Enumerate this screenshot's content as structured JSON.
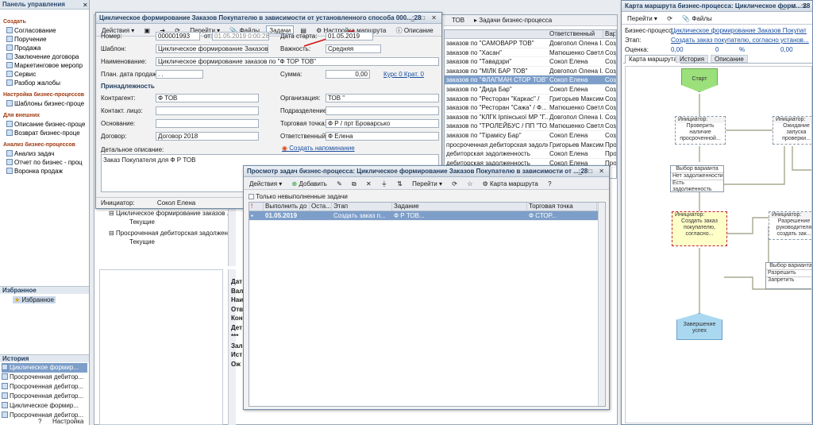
{
  "panel": {
    "title": "Панель управления",
    "sections": [
      {
        "label": "Создать",
        "items": [
          "Согласование",
          "Поручение",
          "Продажа",
          "Заключение договора",
          "Маркетинговое меропр",
          "Сервис",
          "Разбор жалобы"
        ]
      },
      {
        "label": "Настройка бизнес-процессов",
        "items": [
          "Шаблоны бизнес-проце"
        ]
      },
      {
        "label": "Для внешних",
        "items": [
          "Описание бизнес-проце",
          "Возврат бизнес-проце"
        ]
      },
      {
        "label": "Анализ бизнес-процессов",
        "items": [
          "Анализ задач",
          "Отчет по бизнес - проц",
          "Воронка продаж"
        ]
      }
    ],
    "favorites_title": "Избранное",
    "favorites_item": "Избранное",
    "history_title": "История",
    "history_items": [
      "Циклическое формир...",
      "Просроченная дебитор...",
      "Просроченная дебитор...",
      "Просроченная дебитор...",
      "Циклическое формир...",
      "Просроченная дебитор..."
    ],
    "settings": "Настройка"
  },
  "bg": {
    "tab_label": "ТОВ",
    "tasks_label": "Задачи бизнес-процесса",
    "header": [
      "",
      "Ответственный",
      "Вар"
    ],
    "rows": [
      [
        "заказов по \"САМОВАРР ТОВ\"",
        "Довгопол Олена І...",
        "Созд"
      ],
      [
        "заказов по \"Хасан\"",
        "Матюшенко Светл...",
        "Созд"
      ],
      [
        "заказов по \"Тавадзри\"",
        "Сокол Елена",
        "Созд"
      ],
      [
        "заказов по \"МІЛК БАР ТОВ\"",
        "Довгопол Олена І...",
        "Созд"
      ],
      [
        "заказов по \"ФЛАГМАН СТОР ТОВ\"",
        "Сокол Елена",
        "Созд"
      ],
      [
        "заказов по \"Дида Бар\"",
        "Сокол Елена",
        "Созд"
      ],
      [
        "заказов по \"Ресторан \"Каркас\" /",
        "Григорьев Максим",
        "Созд"
      ],
      [
        "заказов по \"Ресторан \"Сажа\" / Ф...",
        "Матюшенко Светл...",
        "Созд"
      ],
      [
        "заказов по \"КЛГК Ірпінської МР \"Г...",
        "Довгопол Олена І...",
        "Созд"
      ],
      [
        "заказов по \"ТРОЛЕЙБУС / ПП \"ТО...",
        "Матюшенко Светл...",
        "Созд"
      ],
      [
        "заказов по \"Тірамісу Бар\"",
        "Сокол Елена",
        "Созд"
      ],
      [
        "просроченная дебиторская задолжен...",
        "Григорьев Максим",
        "Прос"
      ],
      [
        "дебиторская задолженность",
        "Сокол Елена",
        "Прос"
      ],
      [
        "дебиторская задолженность",
        "Сокол Елена",
        "Прос"
      ]
    ],
    "tree": [
      {
        "title": "Циклическое формирование заказов ...",
        "sub": "Текущие"
      },
      {
        "title": "Просроченная дебиторская задолжен...",
        "sub": "Текущие"
      }
    ],
    "detail": [
      "Дат",
      "Вал",
      "Наи",
      "Отв",
      "Кон",
      "Дет",
      "***",
      "Зал",
      "Ист",
      "Ож"
    ]
  },
  "form": {
    "title": "Циклическое формирование Заказов Покупателю в зависимости от установленного способа 000...:28",
    "toolbar": [
      "Действия",
      "Перейти",
      "Файлы",
      "Задачи",
      "Настройка маршрута",
      "Описание"
    ],
    "number_label": "Номер:",
    "number": "000001993",
    "from_label": "от:",
    "from_value": "01.05.2019 0:00:28",
    "start_label": "Дата старта:",
    "start_value": "01.05.2019",
    "template_label": "Шаблон:",
    "template_value": "Циклическое формирование Заказов ...",
    "importance_label": "Важность:",
    "importance_value": "Средняя",
    "name_label": "Наименование:",
    "name_value": "Циклическое формирование заказов по \"Ф              ТОР ТОВ\"",
    "plan_label": "План. дата продажи:",
    "plan_value": ". .",
    "sum_label": "Сумма:",
    "sum_value": "0,00",
    "rate_link": "Курс 0 Крат. 0",
    "section_label": "Принадлежность",
    "contr_label": "Контрагент:",
    "contr_value": "Ф                ТОВ",
    "org_label": "Организация:",
    "org_value": "ТОВ \"",
    "contact_label": "Контакт. лицо:",
    "dept_label": "Подразделение:",
    "basis_label": "Основание:",
    "point_label": "Торговая точка:",
    "point_value": "Ф                  Р / прт Броварсько",
    "contract_label": "Договор:",
    "contract_value": "Договор           2018",
    "resp_label": "Ответственный:",
    "resp_value": "Ф                Елена",
    "desc_label": "Детальное описание:",
    "reminder": "Создать напоминание",
    "desc_text": "Заказ Покупателя для Ф                 Р ТОВ",
    "initiator_label": "Инициатор:",
    "initiator_value": "Сокол Елена"
  },
  "tasks": {
    "title": "Просмотр задач бизнес-процесса: Циклическое формирование Заказов Покупателю в зависимости от ...:28",
    "toolbar": [
      "Действия",
      "Добавить",
      "Перейти",
      "Карта маршрута"
    ],
    "checkbox": "Только невыполненные задачи",
    "header": [
      "",
      "Выполнить до",
      "Оста...",
      "Этап",
      "Задание",
      "Торговая точка"
    ],
    "row": [
      "",
      "01.05.2019",
      "",
      "Создать заказ п...",
      "Ф           Р ТОВ...",
      "Ф           СТОР..."
    ]
  },
  "map": {
    "title": "Карта маршрута бизнес-процесса: Циклическое форм...:28",
    "toolbar": [
      "Перейти",
      "Файлы"
    ],
    "bp_label": "Бизнес-процесс:",
    "bp_value": "Циклическое формирование Заказов Покупат",
    "stage_label": "Этап:",
    "stage_value": "Создать заказ покупателю, согласно установ...",
    "score_label": "Оценка:",
    "score_values": [
      "0,00",
      "0",
      "%",
      "0,00"
    ],
    "tabs": [
      "Карта маршрута",
      "История",
      "Описание"
    ],
    "nodes": {
      "start": "Старт",
      "init1": "Инициатор:",
      "check": "Проверить наличие просроченной...",
      "init2": "Инициатор:",
      "wait": "Ожидание запуска проверки...",
      "choice": "Выбор варианта",
      "no_debt": "Нет задолженности",
      "has_debt": "Есть задолженность",
      "init3": "Инициатор:",
      "create": "Создать заказ покупателю, согласно...",
      "init4": "Инициатор:",
      "permit": "Разрешение руководителя создать зак...",
      "choice2": "Выбор варианта",
      "allow": "Разрешить",
      "deny": "Запретить",
      "end": "Завершение успех"
    }
  },
  "colors": {
    "title": "#1f3b5e",
    "accent": "#7d9ec9",
    "start": "#9be07a",
    "end": "#a9d8f0",
    "active": "#ffffc8"
  }
}
